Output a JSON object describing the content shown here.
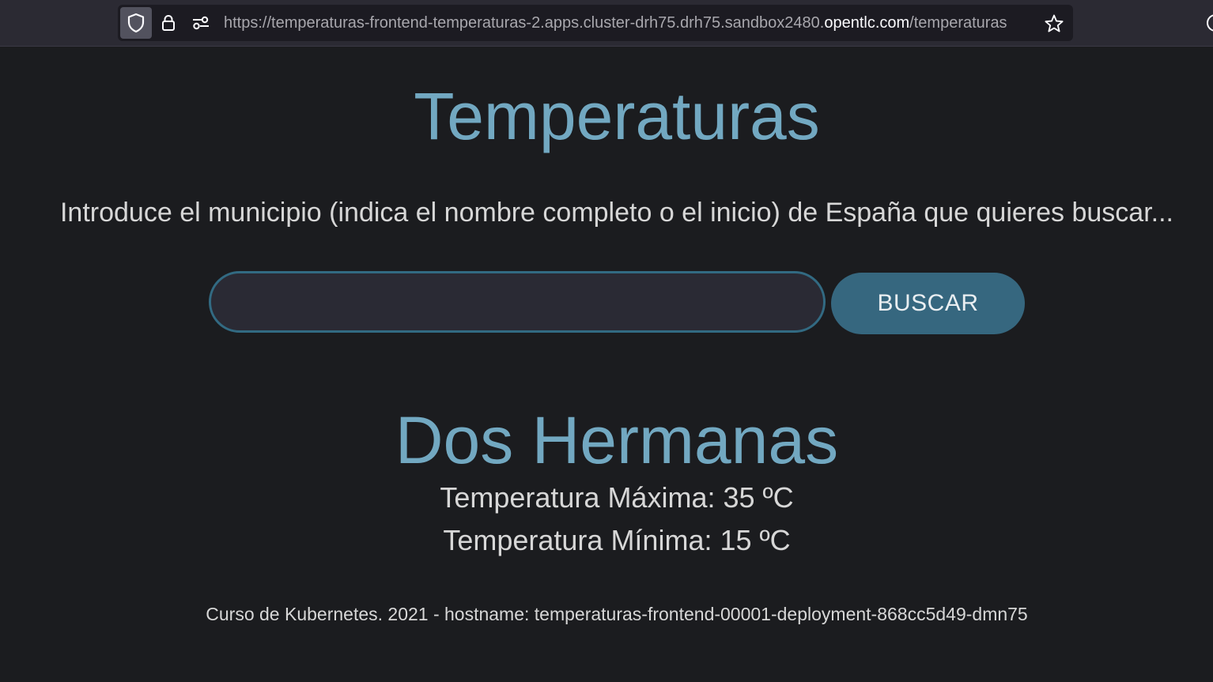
{
  "browser": {
    "url_prefix": "https://temperaturas-frontend-temperaturas-2.apps.cluster-drh75.drh75.sandbox2480.",
    "url_domain": "opentlc.com",
    "url_suffix": "/temperaturas"
  },
  "page": {
    "title": "Temperaturas",
    "instruction": "Introduce el municipio (indica el nombre completo o el inicio) de España que quieres buscar...",
    "search": {
      "value": "",
      "button_label": "BUSCAR"
    },
    "result": {
      "city": "Dos Hermanas",
      "max_label": "Temperatura Máxima: 35 ºC",
      "min_label": "Temperatura Mínima: 15 ºC"
    },
    "footer": "Curso de Kubernetes. 2021 - hostname: temperaturas-frontend-00001-deployment-868cc5d49-dmn75"
  },
  "colors": {
    "accent": "#72a8c1",
    "button": "#36677f",
    "background": "#1b1c1f"
  },
  "icons": {
    "shield": "shield-icon",
    "lock": "lock-icon",
    "permissions": "permissions-icon",
    "bookmark": "star-icon"
  }
}
